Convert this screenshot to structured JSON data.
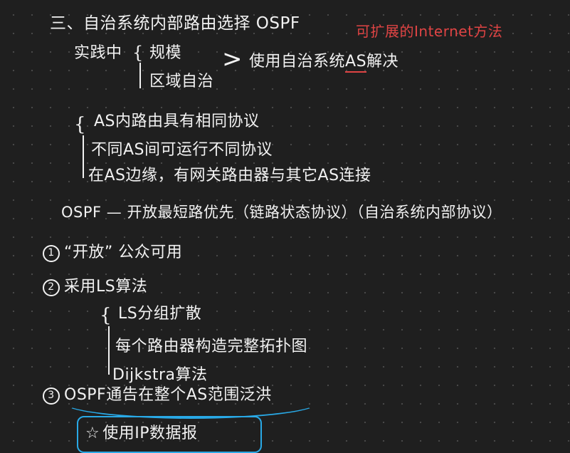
{
  "heading": "三、自治系统内部路由选择 OSPF",
  "red_note": "可扩展的Internet方法",
  "practice_label": "实践中",
  "practice_items": [
    "规模",
    "区域自治"
  ],
  "solution": "使用自治系统",
  "solution_as": "AS",
  "solution_tail": "解决",
  "as_points": [
    "AS内路由具有相同协议",
    "不同AS间可运行不同协议",
    "在AS边缘，有网关路由器与其它AS连接"
  ],
  "ospf_def": "OSPF — 开放最短路优先（链路状态协议）（自治系统内部协议）",
  "points": [
    {
      "num": "1",
      "text": "“开放” 公众可用"
    },
    {
      "num": "2",
      "text": "采用LS算法"
    }
  ],
  "ls_sub": [
    "LS分组扩散",
    "每个路由器构造完整拓扑图",
    "Dijkstra算法"
  ],
  "point3": {
    "num": "3",
    "text": "OSPF通告在整个AS范围泛洪"
  },
  "boxed": "使用IP数据报",
  "colors": {
    "background": "#1f1f1f",
    "ink": "#f2f2f2",
    "red_ink": "#e04444",
    "cyan_ink": "#29a9e6"
  },
  "icons": [
    "star-icon"
  ]
}
